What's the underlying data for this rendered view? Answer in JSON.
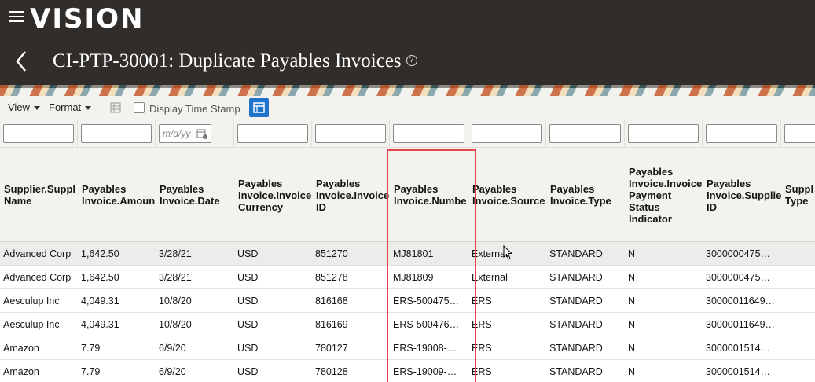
{
  "app": {
    "logo": "VISION",
    "page_title": "CI-PTP-30001: Duplicate Payables Invoices",
    "help_glyph": "?"
  },
  "toolbar": {
    "view_label": "View",
    "format_label": "Format",
    "display_timestamp_label": "Display Time Stamp"
  },
  "filters": {
    "date_placeholder": "m/d/yy"
  },
  "columns": [
    "Supplier.Supplier Name",
    "Payables Invoice.Amount",
    "Payables Invoice.Date",
    "Payables Invoice.Invoice Currency",
    "Payables Invoice.Invoice ID",
    "Payables Invoice.Number",
    "Payables Invoice.Source",
    "Payables Invoice.Type",
    "Payables Invoice.Invoice Payment Status Indicator",
    "Payables Invoice.Supplier ID",
    "Supplier Type"
  ],
  "column_headers_visible": [
    "Supplier.Suppl\nName",
    "Payables\nInvoice.Amoun",
    "Payables\nInvoice.Date",
    "Payables\nInvoice.Invoice\nCurrency",
    "Payables\nInvoice.Invoice\nID",
    "Payables\nInvoice.Numbe",
    "Payables\nInvoice.Source",
    "Payables\nInvoice.Type",
    "Payables\nInvoice.Invoice\nPayment\nStatus\nIndicator",
    "Payables\nInvoice.Supplie\nID",
    "Suppl\nType"
  ],
  "rows": [
    [
      "Advanced Corp",
      "1,642.50",
      "3/28/21",
      "USD",
      "851270",
      "MJ81801",
      "External",
      "STANDARD",
      "N",
      "3000000475…",
      ""
    ],
    [
      "Advanced Corp",
      "1,642.50",
      "3/28/21",
      "USD",
      "851278",
      "MJ81809",
      "External",
      "STANDARD",
      "N",
      "3000000475…",
      ""
    ],
    [
      "Aesculup Inc",
      "4,049.31",
      "10/8/20",
      "USD",
      "816168",
      "ERS-500475…",
      "ERS",
      "STANDARD",
      "N",
      "30000011649…",
      ""
    ],
    [
      "Aesculup Inc",
      "4,049.31",
      "10/8/20",
      "USD",
      "816169",
      "ERS-500476…",
      "ERS",
      "STANDARD",
      "N",
      "30000011649…",
      ""
    ],
    [
      "Amazon",
      "7.79",
      "6/9/20",
      "USD",
      "780127",
      "ERS-19008-…",
      "ERS",
      "STANDARD",
      "N",
      "3000001514…",
      ""
    ],
    [
      "Amazon",
      "7.79",
      "6/9/20",
      "USD",
      "780128",
      "ERS-19009-…",
      "ERS",
      "STANDARD",
      "N",
      "3000001514…",
      ""
    ]
  ],
  "colors": {
    "header_bg": "#312d2a",
    "accent": "#1f73c8",
    "highlight": "#e0454c"
  }
}
